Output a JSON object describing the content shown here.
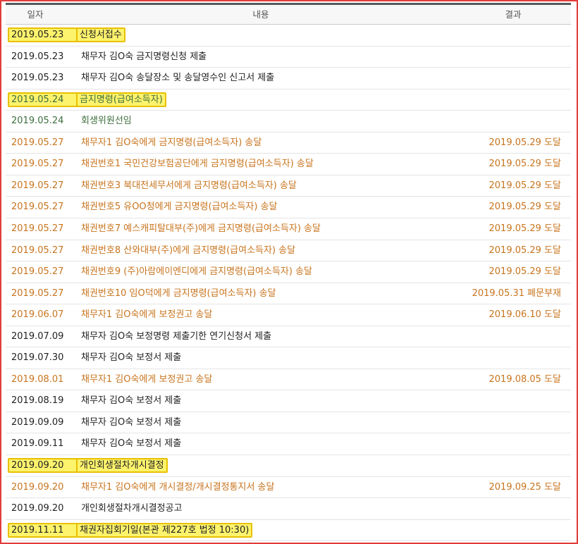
{
  "header": {
    "date": "일자",
    "content": "내용",
    "result": "결과"
  },
  "rows": [
    {
      "date": "2019.05.23",
      "desc": "신청서접수",
      "result": "",
      "kind": "black",
      "hl": true
    },
    {
      "date": "2019.05.23",
      "desc": "채무자 김O숙 금지명령신청 제출",
      "result": "",
      "kind": "black",
      "hl": false
    },
    {
      "date": "2019.05.23",
      "desc": "채무자 김O숙 송달장소 및 송달영수인 신고서 제출",
      "result": "",
      "kind": "black",
      "hl": false
    },
    {
      "date": "2019.05.24",
      "desc": "금지명령(급여소득자)",
      "result": "",
      "kind": "green",
      "hl": true
    },
    {
      "date": "2019.05.24",
      "desc": "회생위원선임",
      "result": "",
      "kind": "green",
      "hl": false
    },
    {
      "date": "2019.05.27",
      "desc": "채무자1 김O숙에게 금지명령(급여소득자) 송달",
      "result": "2019.05.29 도달",
      "kind": "orange",
      "hl": false
    },
    {
      "date": "2019.05.27",
      "desc": "채권번호1 국민건강보험공단에게 금지명령(급여소득자) 송달",
      "result": "2019.05.29 도달",
      "kind": "orange",
      "hl": false
    },
    {
      "date": "2019.05.27",
      "desc": "채권번호3 북대전세무서에게 금지명령(급여소득자) 송달",
      "result": "2019.05.29 도달",
      "kind": "orange",
      "hl": false
    },
    {
      "date": "2019.05.27",
      "desc": "채권번호5 유OO청에게 금지명령(급여소득자) 송달",
      "result": "2019.05.29 도달",
      "kind": "orange",
      "hl": false
    },
    {
      "date": "2019.05.27",
      "desc": "채권번호7 예스캐피탈대부(주)에게 금지명령(급여소득자) 송달",
      "result": "2019.05.29 도달",
      "kind": "orange",
      "hl": false
    },
    {
      "date": "2019.05.27",
      "desc": "채권번호8 산와대부(주)에게 금지명령(급여소득자) 송달",
      "result": "2019.05.29 도달",
      "kind": "orange",
      "hl": false
    },
    {
      "date": "2019.05.27",
      "desc": "채권번호9 (주)아람에이엔디에게 금지명령(급여소득자) 송달",
      "result": "2019.05.29 도달",
      "kind": "orange",
      "hl": false
    },
    {
      "date": "2019.05.27",
      "desc": "채권번호10 임O덕에게 금지명령(급여소득자) 송달",
      "result": "2019.05.31 폐문부재",
      "kind": "orange",
      "hl": false
    },
    {
      "date": "2019.06.07",
      "desc": "채무자1 김O숙에게 보정권고 송달",
      "result": "2019.06.10 도달",
      "kind": "orange",
      "hl": false
    },
    {
      "date": "2019.07.09",
      "desc": "채무자 김O숙 보정명령 제출기한 연기신청서 제출",
      "result": "",
      "kind": "black",
      "hl": false
    },
    {
      "date": "2019.07.30",
      "desc": "채무자 김O숙 보정서 제출",
      "result": "",
      "kind": "black",
      "hl": false
    },
    {
      "date": "2019.08.01",
      "desc": "채무자1 김O숙에게 보정권고 송달",
      "result": "2019.08.05 도달",
      "kind": "orange",
      "hl": false
    },
    {
      "date": "2019.08.19",
      "desc": "채무자 김O숙 보정서 제출",
      "result": "",
      "kind": "black",
      "hl": false
    },
    {
      "date": "2019.09.09",
      "desc": "채무자 김O숙 보정서 제출",
      "result": "",
      "kind": "black",
      "hl": false
    },
    {
      "date": "2019.09.11",
      "desc": "채무자 김O숙 보정서 제출",
      "result": "",
      "kind": "black",
      "hl": false
    },
    {
      "date": "2019.09.20",
      "desc": "개인회생절차개시결정",
      "result": "",
      "kind": "black",
      "hl": true
    },
    {
      "date": "2019.09.20",
      "desc": "채무자1 김O숙에게 개시결정/개시결정통지서 송달",
      "result": "2019.09.25 도달",
      "kind": "orange",
      "hl": false
    },
    {
      "date": "2019.09.20",
      "desc": "개인회생절차개시결정공고",
      "result": "",
      "kind": "black",
      "hl": false
    },
    {
      "date": "2019.11.11",
      "desc": "채권자집회기일(본관 제227호 법정 10:30)",
      "result": "",
      "kind": "black",
      "hl": true
    }
  ],
  "colors": {
    "black": "#222222",
    "orange": "#c8741e",
    "green": "#3d6e3d",
    "highlight": "#fdf36c",
    "frame": "#e23a3a"
  }
}
